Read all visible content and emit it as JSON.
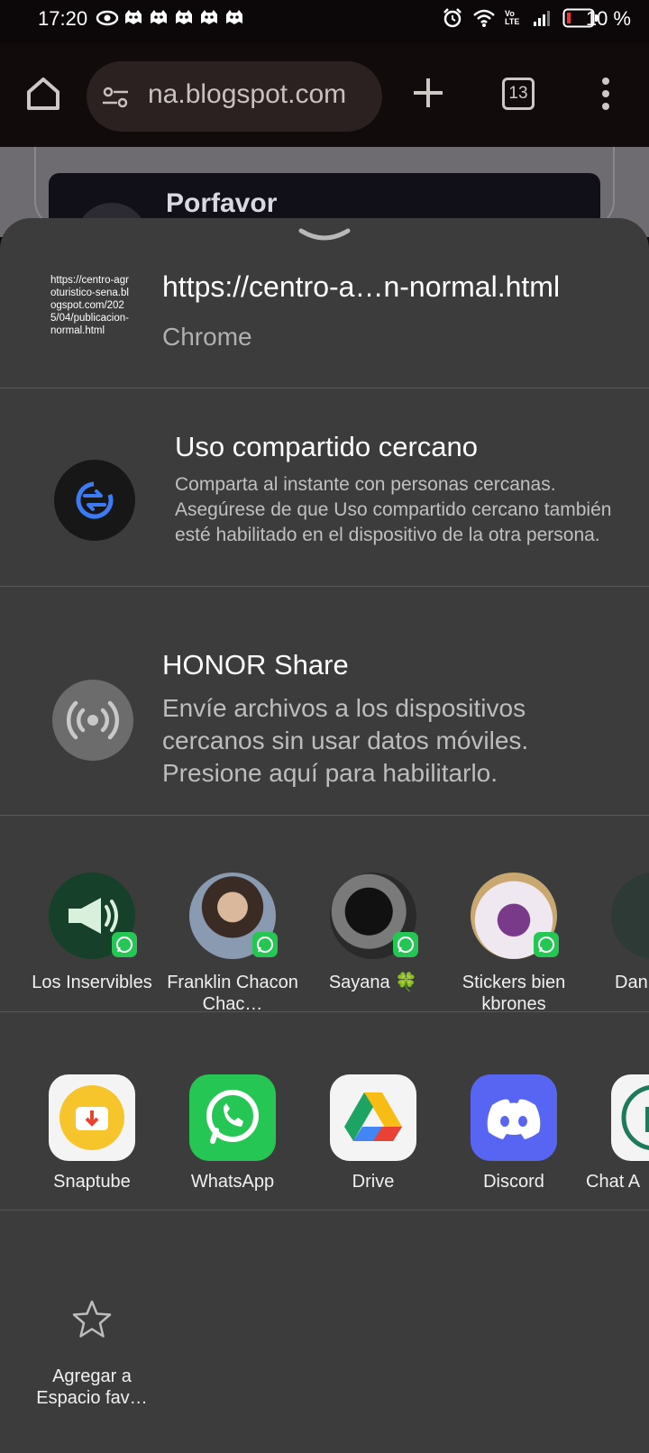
{
  "status_bar": {
    "time": "17:20",
    "network": "Vo LTE",
    "battery": "10 %"
  },
  "toolbar": {
    "url": "na.blogspot.com",
    "tab_count": "13"
  },
  "page": {
    "heading": "Porfavor"
  },
  "share_sheet": {
    "preview": {
      "thumbnail_text": "https://centro-agroturistico-sena.blogspot.com/2025/04/publicacion-normal.html",
      "url": "https://centro-a…n-normal.html",
      "app": "Chrome"
    },
    "nearby": {
      "title": "Uso compartido cercano",
      "description": "Comparta al instante con personas cercanas. Asegúrese de que Uso compartido cercano también esté habilitado en el dispositivo de la otra persona."
    },
    "honor": {
      "title": "HONOR Share",
      "description": "Envíe archivos a los dispositivos cercanos sin usar datos móviles. Presione aquí para habilitarlo."
    },
    "contacts": [
      {
        "name": "Los Inservibles"
      },
      {
        "name": "Franklin Chacon Chac…"
      },
      {
        "name": "Sayana 🍀"
      },
      {
        "name": "Stickers bien kbrones"
      },
      {
        "name": "Dan"
      }
    ],
    "apps": [
      {
        "name": "Snaptube",
        "icon": "snaptube-icon"
      },
      {
        "name": "WhatsApp",
        "icon": "whatsapp-icon"
      },
      {
        "name": "Drive",
        "icon": "drive-icon"
      },
      {
        "name": "Discord",
        "icon": "discord-icon"
      },
      {
        "name": "Chat A",
        "icon": "chat-app-icon"
      }
    ],
    "favorite": {
      "label": "Agregar a Espacio fav…"
    }
  },
  "colors": {
    "sheet_bg": "#3c3c3c",
    "whatsapp_green": "#25c653",
    "discord_blue": "#5865f2",
    "snaptube_yellow": "#f6c52c",
    "nearby_blue": "#3d7bf4"
  }
}
